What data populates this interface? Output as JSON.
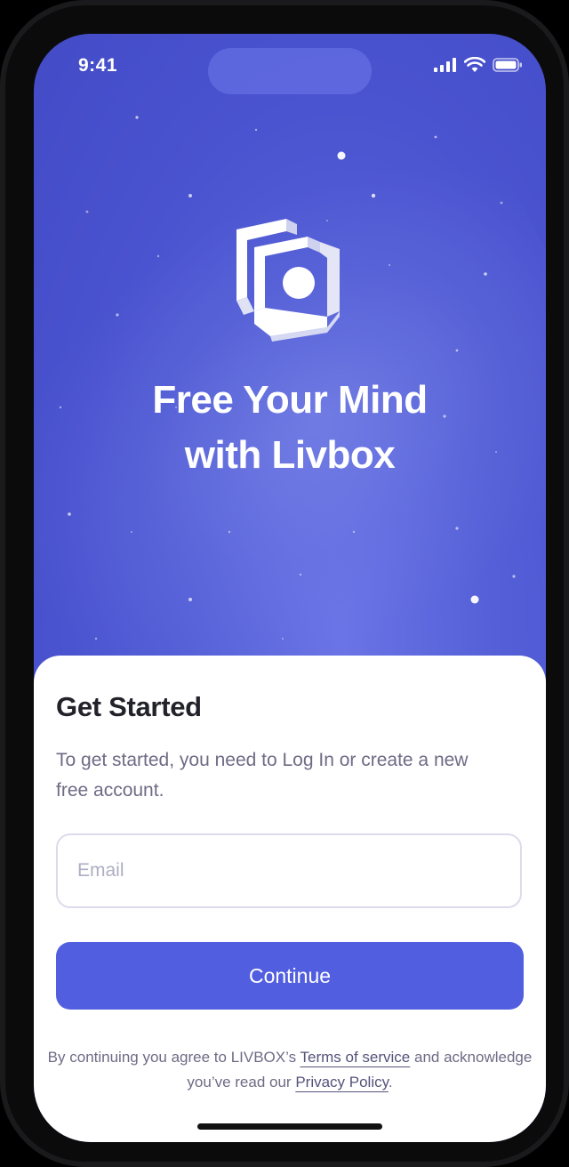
{
  "status_bar": {
    "time": "9:41",
    "icons": [
      "signal-icon",
      "wifi-icon",
      "battery-icon"
    ]
  },
  "hero": {
    "logo_icon": "livbox-logo-icon",
    "headline_line1": "Free Your Mind",
    "headline_line2": "with Livbox"
  },
  "sheet": {
    "title": "Get Started",
    "description": "To get started, you need to Log In or create a new free account.",
    "email": {
      "placeholder": "Email",
      "value": ""
    },
    "continue_label": "Continue",
    "legal": {
      "prefix": "By continuing you agree to LIVBOX’s ",
      "terms_link": "Terms of service",
      "middle": " and acknowledge you’ve read our ",
      "privacy_link": "Privacy Policy",
      "suffix": "."
    }
  },
  "colors": {
    "background_blue": "#4a53cf",
    "accent": "#525ee0",
    "title_text": "#22222a",
    "body_text": "#6e6b85"
  }
}
